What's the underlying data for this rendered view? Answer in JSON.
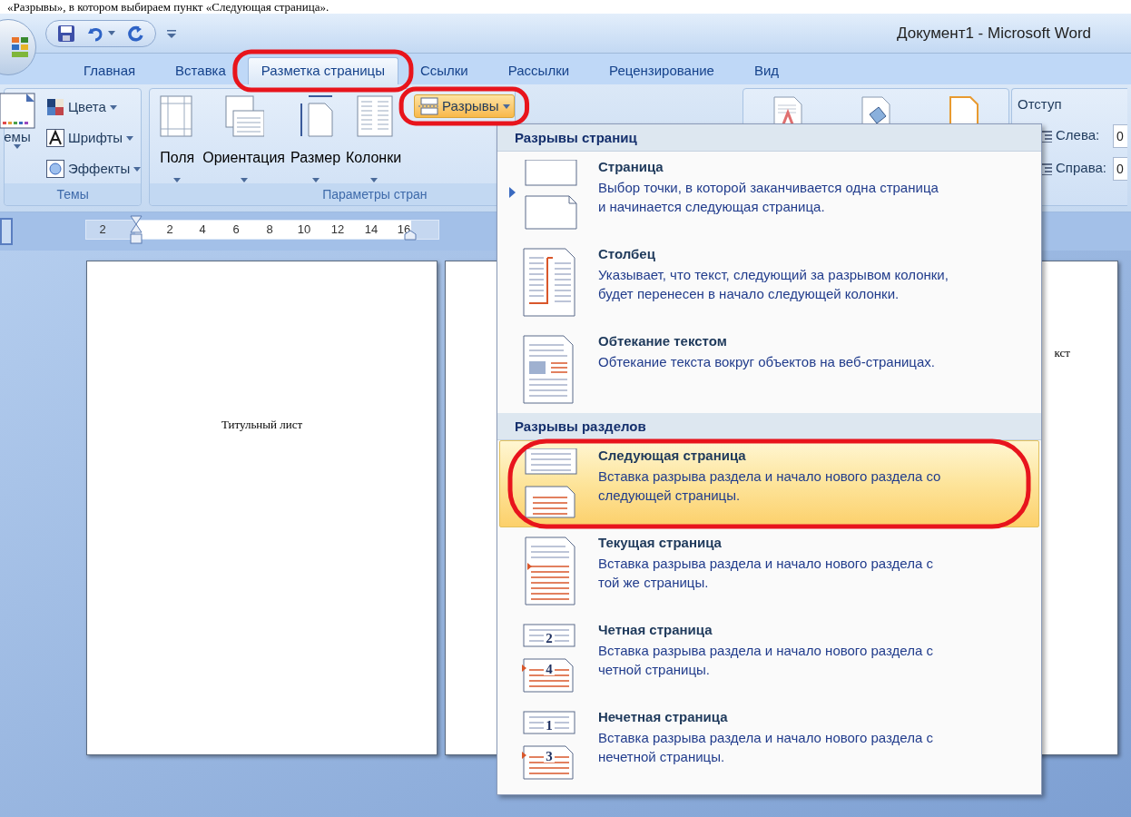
{
  "caption": "«Разрывы», в котором выбираем пункт «Следующая страница».",
  "window": {
    "title": "Документ1 - Microsoft Word"
  },
  "tabs": [
    {
      "label": "Главная",
      "selected": false,
      "circled": false
    },
    {
      "label": "Вставка",
      "selected": false,
      "circled": false
    },
    {
      "label": "Разметка страницы",
      "selected": true,
      "circled": true
    },
    {
      "label": "Ссылки",
      "selected": false,
      "circled": false
    },
    {
      "label": "Рассылки",
      "selected": false,
      "circled": false
    },
    {
      "label": "Рецензирование",
      "selected": false,
      "circled": false
    },
    {
      "label": "Вид",
      "selected": false,
      "circled": false
    }
  ],
  "ribbon": {
    "themes_group": {
      "title": "Темы",
      "themes_button": "емы",
      "buttons": [
        {
          "label": "Цвета",
          "kind": "colors"
        },
        {
          "label": "Шрифты",
          "kind": "fonts"
        },
        {
          "label": "Эффекты",
          "kind": "effects"
        }
      ]
    },
    "page_setup_group": {
      "title": "Параметры стран",
      "buttons": [
        {
          "label": "Поля",
          "kind": "margins"
        },
        {
          "label": "Ориентация",
          "kind": "orientation"
        },
        {
          "label": "Размер",
          "kind": "size"
        },
        {
          "label": "Колонки",
          "kind": "columns"
        }
      ],
      "breaks_button": {
        "label": "Разрывы",
        "pressed": true,
        "circled": true
      }
    },
    "indent_group": {
      "title": "Отступ",
      "fields": [
        {
          "label": "Слева:",
          "value": "0"
        },
        {
          "label": "Справа:",
          "value": "0"
        }
      ]
    }
  },
  "ruler": {
    "labels": [
      "2",
      "2",
      "4",
      "6",
      "8",
      "10",
      "12",
      "14",
      "16"
    ]
  },
  "document": {
    "pages": [
      {
        "text": "Титульный лист"
      },
      {
        "text": "кст"
      }
    ]
  },
  "breaks_menu": {
    "sections": [
      {
        "title": "Разрывы страниц",
        "items": [
          {
            "kind": "page",
            "title": "Страница",
            "description": "Выбор точки, в которой заканчивается одна страница\nи начинается следующая страница.",
            "selected": false,
            "circled": false
          },
          {
            "kind": "column",
            "title": "Столбец",
            "description": "Указывает, что текст, следующий за разрывом колонки,\nбудет перенесен в начало следующей колонки.",
            "selected": false,
            "circled": false
          },
          {
            "kind": "wrapping",
            "title": "Обтекание текстом",
            "description": "Обтекание текста вокруг объектов на веб-страницах.",
            "selected": false,
            "circled": false
          }
        ]
      },
      {
        "title": "Разрывы разделов",
        "items": [
          {
            "kind": "next_page",
            "title": "Следующая страница",
            "description": "Вставка разрыва раздела и начало нового раздела со\nследующей страницы.",
            "selected": true,
            "circled": true
          },
          {
            "kind": "continuous",
            "title": "Текущая страница",
            "description": "Вставка разрыва раздела и начало нового раздела с\nтой же страницы.",
            "selected": false,
            "circled": false
          },
          {
            "kind": "numbered",
            "numbers": [
              "2",
              "4"
            ],
            "title": "Четная страница",
            "description": "Вставка разрыва раздела и начало нового раздела с\nчетной страницы.",
            "selected": false,
            "circled": false
          },
          {
            "kind": "numbered",
            "numbers": [
              "1",
              "3"
            ],
            "title": "Нечетная страница",
            "description": "Вставка разрыва раздела и начало нового раздела с\nнечетной страницы.",
            "selected": false,
            "circled": false
          }
        ]
      }
    ]
  }
}
